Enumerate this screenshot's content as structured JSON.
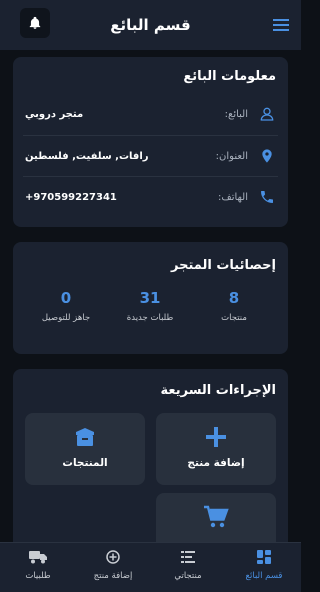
{
  "header": {
    "title": "قسم البائع",
    "menu_icon": "menu-icon",
    "notification_icon": "bell-icon"
  },
  "seller_info": {
    "title": "معلومات البائع",
    "rows": [
      {
        "label": "البائع:",
        "value": "متجر دروبي",
        "icon": "user-icon"
      },
      {
        "label": "العنوان:",
        "value": "رافات, سلفيت, فلسطين",
        "icon": "location-icon"
      },
      {
        "label": "الهاتف:",
        "value": "+970599227341",
        "icon": "phone-icon"
      }
    ]
  },
  "stats": {
    "title": "إحصائيات المتجر",
    "items": [
      {
        "value": "8",
        "label": "منتجات"
      },
      {
        "value": "31",
        "label": "طلبات جديدة"
      },
      {
        "value": "0",
        "label": "جاهز للتوصيل"
      }
    ]
  },
  "quick_actions": {
    "title": "الإجراءات السريعة",
    "items": [
      {
        "label": "إضافة منتج",
        "icon": "plus-icon"
      },
      {
        "label": "المنتجات",
        "icon": "box-icon"
      },
      {
        "label": "",
        "icon": "cart-icon"
      }
    ]
  },
  "bottom_nav": [
    {
      "label": "قسم البائع",
      "icon": "dashboard-icon",
      "active": true
    },
    {
      "label": "منتجاتي",
      "icon": "list-icon",
      "active": false
    },
    {
      "label": "إضافة منتج",
      "icon": "add-circle-icon",
      "active": false
    },
    {
      "label": "طلبيات",
      "icon": "truck-icon",
      "active": false
    }
  ],
  "colors": {
    "background": "#0d1117",
    "card": "#1b2230",
    "accent": "#4a90e2"
  }
}
